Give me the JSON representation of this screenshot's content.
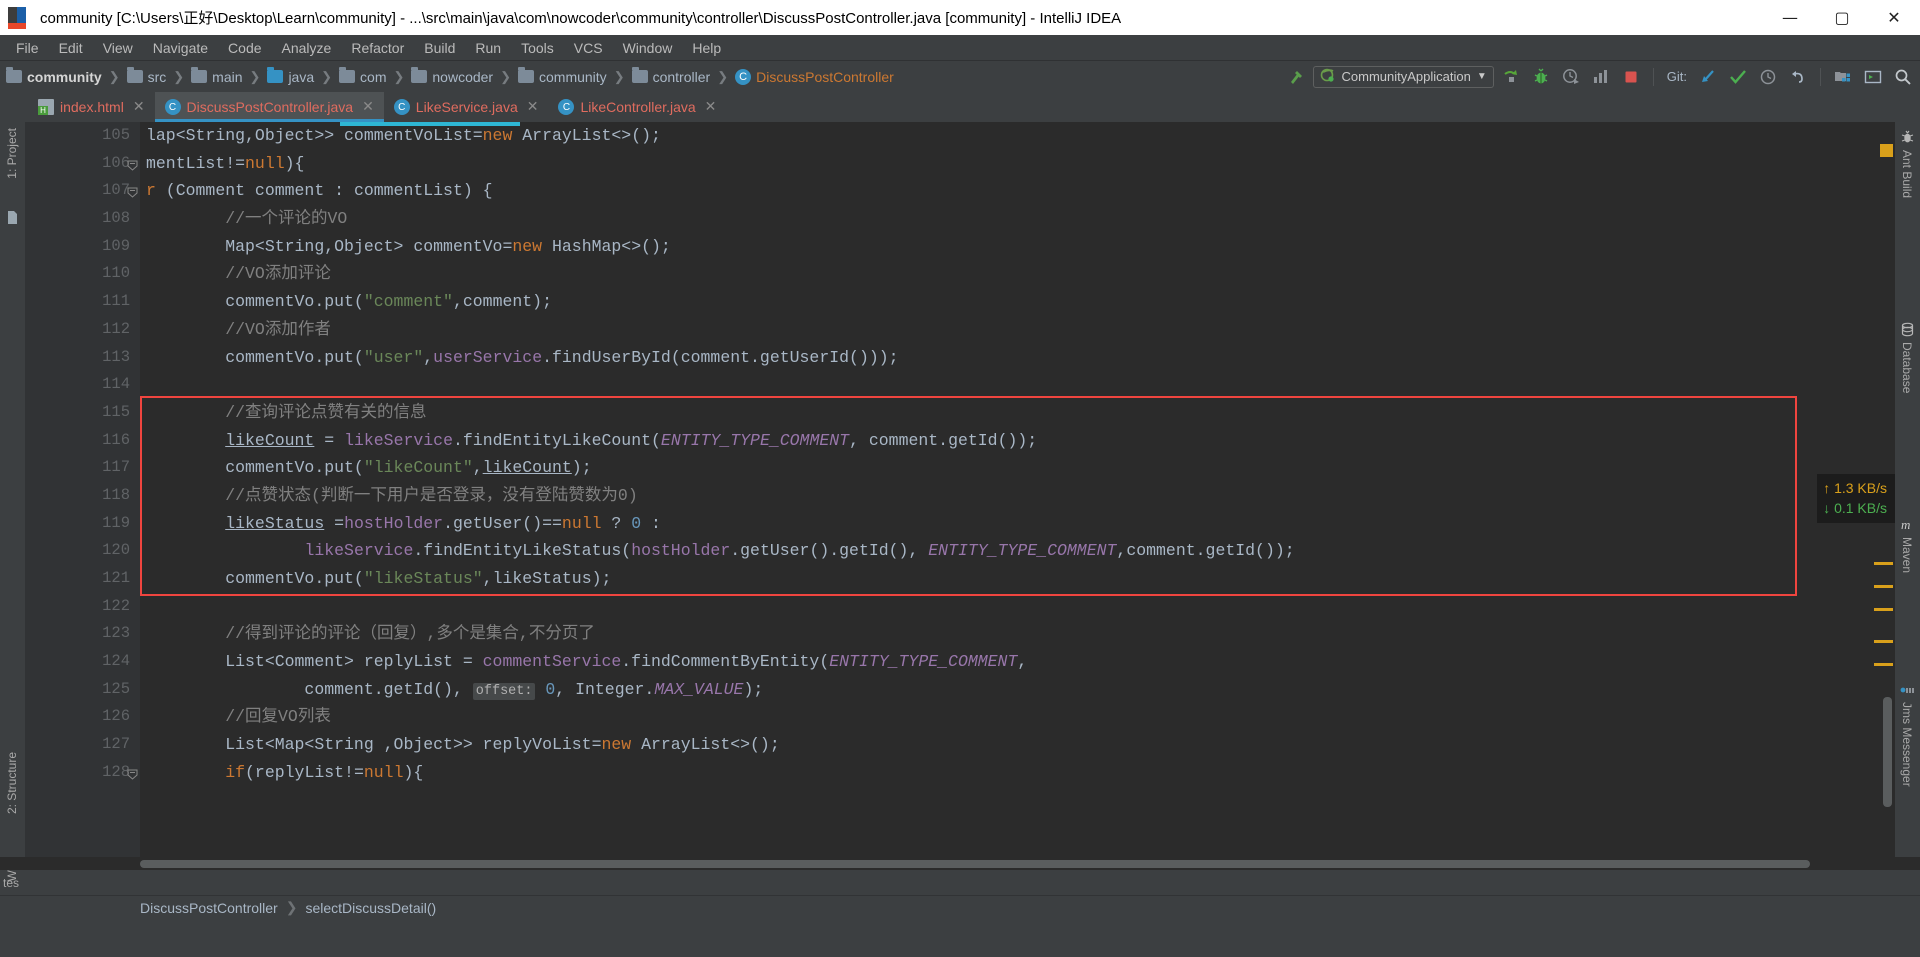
{
  "window": {
    "title": "community [C:\\Users\\正好\\Desktop\\Learn\\community] - ...\\src\\main\\java\\com\\nowcoder\\community\\controller\\DiscussPostController.java [community] - IntelliJ IDEA",
    "minimize": "—",
    "maximize": "▢",
    "close": "✕",
    "app_icon": "intellij-idea-logo"
  },
  "menubar": {
    "items": [
      "File",
      "Edit",
      "View",
      "Navigate",
      "Code",
      "Analyze",
      "Refactor",
      "Build",
      "Run",
      "Tools",
      "VCS",
      "Window",
      "Help"
    ]
  },
  "breadcrumb": {
    "items": [
      {
        "label": "community",
        "icon": "folder-icon",
        "bold": true
      },
      {
        "label": "src",
        "icon": "folder-icon",
        "bold": false
      },
      {
        "label": "main",
        "icon": "folder-icon",
        "bold": false
      },
      {
        "label": "java",
        "icon": "folder-icon-source",
        "bold": false
      },
      {
        "label": "com",
        "icon": "folder-icon",
        "bold": false
      },
      {
        "label": "nowcoder",
        "icon": "folder-icon",
        "bold": false
      },
      {
        "label": "community",
        "icon": "folder-icon",
        "bold": false
      },
      {
        "label": "controller",
        "icon": "folder-icon",
        "bold": false
      },
      {
        "label": "DiscussPostController",
        "icon": "java-class-icon",
        "bold": false
      }
    ],
    "separator": "❯"
  },
  "toolbar": {
    "build_label": "build-hammer-icon",
    "run_config": "CommunityApplication",
    "run_config_icon": "spring-boot-icon",
    "dropdown_caret": "▼",
    "run_button": "run-icon",
    "debug_button": "debug-icon",
    "coverage_button": "run-with-coverage-icon",
    "profile_button": "profiler-icon",
    "stop_button": "stop-icon",
    "git_label": "Git:",
    "git_update": "update-project-icon",
    "git_commit": "commit-icon",
    "git_history": "history-icon",
    "git_rollback": "rollback-icon",
    "structure_button": "project-structure-icon",
    "terminal_button": "terminal-icon",
    "search_button": "search-everywhere-icon"
  },
  "tabs": [
    {
      "label": "index.html",
      "icon": "html-file-icon",
      "active": false,
      "close": "✕"
    },
    {
      "label": "DiscussPostController.java",
      "icon": "java-class-icon",
      "active": true,
      "close": "✕"
    },
    {
      "label": "LikeService.java",
      "icon": "java-class-icon",
      "active": false,
      "close": "✕"
    },
    {
      "label": "LikeController.java",
      "icon": "java-class-icon",
      "active": false,
      "close": "✕"
    }
  ],
  "left_tool_window": {
    "project_label": "1: Project",
    "structure_label": "2: Structure",
    "web_label": "Web",
    "favorites_label": "tes"
  },
  "right_tool_window": {
    "items": [
      {
        "label": "Ant Build",
        "icon": "ant-icon"
      },
      {
        "label": "Database",
        "icon": "database-icon"
      },
      {
        "label": "Maven",
        "icon": "maven-icon"
      },
      {
        "label": "Jms Messenger",
        "icon": "jms-icon"
      }
    ]
  },
  "network": {
    "upload": "1.3 KB/s",
    "download": "0.1 KB/s",
    "up_arrow": "↑",
    "down_arrow": "↓"
  },
  "statusbar": {
    "class_name": "DiscussPostController",
    "separator": "❯",
    "method_name": "selectDiscussDetail()"
  },
  "editor": {
    "first_line_number": 105,
    "highlight_color": "#f0453f",
    "lines": [
      {
        "n": 105,
        "tokens": [
          {
            "t": "lap<String,Object>> commentVoList=",
            "c": "ident"
          },
          {
            "t": "new",
            "c": "kw"
          },
          {
            "t": " ArrayList<>();",
            "c": "ident"
          }
        ]
      },
      {
        "n": 106,
        "tokens": [
          {
            "t": "mentList!=",
            "c": "ident"
          },
          {
            "t": "null",
            "c": "kw"
          },
          {
            "t": "){",
            "c": "ident"
          }
        ]
      },
      {
        "n": 107,
        "tokens": [
          {
            "t": "r",
            "c": "kw"
          },
          {
            "t": " (Comment comment : commentList) {",
            "c": "ident"
          }
        ]
      },
      {
        "n": 108,
        "tokens": [
          {
            "t": "        //一个评论的VO",
            "c": "cmt"
          }
        ]
      },
      {
        "n": 109,
        "tokens": [
          {
            "t": "        Map<String,Object> commentVo=",
            "c": "ident"
          },
          {
            "t": "new",
            "c": "kw"
          },
          {
            "t": " HashMap<>();",
            "c": "ident"
          }
        ]
      },
      {
        "n": 110,
        "tokens": [
          {
            "t": "        //VO添加评论",
            "c": "cmt"
          }
        ]
      },
      {
        "n": 111,
        "tokens": [
          {
            "t": "        commentVo.put(",
            "c": "ident"
          },
          {
            "t": "\"comment\"",
            "c": "str"
          },
          {
            "t": ",comment);",
            "c": "ident"
          }
        ]
      },
      {
        "n": 112,
        "tokens": [
          {
            "t": "        //VO添加作者",
            "c": "cmt"
          }
        ]
      },
      {
        "n": 113,
        "tokens": [
          {
            "t": "        commentVo.put(",
            "c": "ident"
          },
          {
            "t": "\"user\"",
            "c": "str"
          },
          {
            "t": ",",
            "c": "ident"
          },
          {
            "t": "userService",
            "c": "fld"
          },
          {
            "t": ".findUserById(comment.getUserId()));",
            "c": "ident"
          }
        ]
      },
      {
        "n": 114,
        "tokens": [
          {
            "t": "",
            "c": "ident"
          }
        ]
      },
      {
        "n": 115,
        "tokens": [
          {
            "t": "        //查询评论点赞有关的信息",
            "c": "cmt"
          }
        ]
      },
      {
        "n": 116,
        "tokens": [
          {
            "t": "        ",
            "c": "ident"
          },
          {
            "t": "likeCount",
            "c": "ident under"
          },
          {
            "t": " = ",
            "c": "ident"
          },
          {
            "t": "likeService",
            "c": "fld"
          },
          {
            "t": ".findEntityLikeCount(",
            "c": "ident"
          },
          {
            "t": "ENTITY_TYPE_COMMENT",
            "c": "sconst"
          },
          {
            "t": ", comment.getId());",
            "c": "ident"
          }
        ]
      },
      {
        "n": 117,
        "tokens": [
          {
            "t": "        commentVo.put(",
            "c": "ident"
          },
          {
            "t": "\"likeCount\"",
            "c": "str"
          },
          {
            "t": ",",
            "c": "ident"
          },
          {
            "t": "likeCount",
            "c": "ident under"
          },
          {
            "t": ");",
            "c": "ident"
          }
        ]
      },
      {
        "n": 118,
        "tokens": [
          {
            "t": "        //点赞状态(判断一下用户是否登录，没有登陆赞数为0)",
            "c": "cmt"
          }
        ]
      },
      {
        "n": 119,
        "tokens": [
          {
            "t": "        ",
            "c": "ident"
          },
          {
            "t": "likeStatus",
            "c": "ident under"
          },
          {
            "t": " =",
            "c": "ident"
          },
          {
            "t": "hostHolder",
            "c": "fld"
          },
          {
            "t": ".getUser()==",
            "c": "ident"
          },
          {
            "t": "null",
            "c": "kw"
          },
          {
            "t": " ? ",
            "c": "ident"
          },
          {
            "t": "0",
            "c": "num"
          },
          {
            "t": " :",
            "c": "ident"
          }
        ]
      },
      {
        "n": 120,
        "tokens": [
          {
            "t": "                ",
            "c": "ident"
          },
          {
            "t": "likeService",
            "c": "fld"
          },
          {
            "t": ".findEntityLikeStatus(",
            "c": "ident"
          },
          {
            "t": "hostHolder",
            "c": "fld"
          },
          {
            "t": ".getUser().getId(), ",
            "c": "ident"
          },
          {
            "t": "ENTITY_TYPE_COMMENT",
            "c": "sconst"
          },
          {
            "t": ",comment.getId());",
            "c": "ident"
          }
        ]
      },
      {
        "n": 121,
        "tokens": [
          {
            "t": "        commentVo.put(",
            "c": "ident"
          },
          {
            "t": "\"likeStatus\"",
            "c": "str"
          },
          {
            "t": ",likeStatus);",
            "c": "ident"
          }
        ]
      },
      {
        "n": 122,
        "tokens": [
          {
            "t": "",
            "c": "ident"
          }
        ]
      },
      {
        "n": 123,
        "tokens": [
          {
            "t": "        //得到评论的评论（回复）,多个是集合,不分页了",
            "c": "cmt"
          }
        ]
      },
      {
        "n": 124,
        "tokens": [
          {
            "t": "        List<Comment> replyList = ",
            "c": "ident"
          },
          {
            "t": "commentService",
            "c": "fld"
          },
          {
            "t": ".findCommentByEntity(",
            "c": "ident"
          },
          {
            "t": "ENTITY_TYPE_COMMENT",
            "c": "sconst"
          },
          {
            "t": ",",
            "c": "ident"
          }
        ]
      },
      {
        "n": 125,
        "tokens": [
          {
            "t": "                comment.getId(), ",
            "c": "ident"
          },
          {
            "t": "offset:",
            "c": "param"
          },
          {
            "t": " ",
            "c": "ident"
          },
          {
            "t": "0",
            "c": "num"
          },
          {
            "t": ", Integer.",
            "c": "ident"
          },
          {
            "t": "MAX_VALUE",
            "c": "sconst"
          },
          {
            "t": ");",
            "c": "ident"
          }
        ]
      },
      {
        "n": 126,
        "tokens": [
          {
            "t": "        //回复VO列表",
            "c": "cmt"
          }
        ]
      },
      {
        "n": 127,
        "tokens": [
          {
            "t": "        List<Map<String ,Object>> replyVoList=",
            "c": "ident"
          },
          {
            "t": "new",
            "c": "kw"
          },
          {
            "t": " ArrayList<>();",
            "c": "ident"
          }
        ]
      },
      {
        "n": 128,
        "tokens": [
          {
            "t": "        ",
            "c": "ident"
          },
          {
            "t": "if",
            "c": "kw"
          },
          {
            "t": "(replyList!=",
            "c": "ident"
          },
          {
            "t": "null",
            "c": "kw"
          },
          {
            "t": "){",
            "c": "ident"
          }
        ]
      }
    ]
  }
}
